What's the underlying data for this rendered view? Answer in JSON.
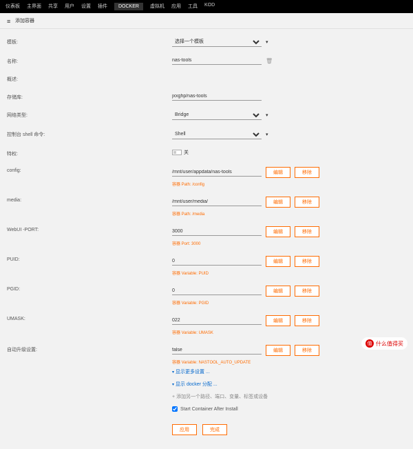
{
  "nav": {
    "items": [
      "仪表板",
      "主界面",
      "共享",
      "用户",
      "设置",
      "插件",
      "DOCKER",
      "虚拟机",
      "应用",
      "工具",
      "KOD"
    ],
    "active": 6
  },
  "header": {
    "title": "添加容器"
  },
  "labels": {
    "template": "模板:",
    "name": "名称:",
    "overview": "概述:",
    "repo": "存储库:",
    "network": "网络类型:",
    "shell": "控制台 shell 命令:",
    "priv": "特权:",
    "config": "config:",
    "media": "media:",
    "webui": "WebUI -PORT:",
    "puid": "PUID:",
    "pgid": "PGID:",
    "umask": "UMASK:",
    "autoupdate": "自动升级设置:"
  },
  "values": {
    "template": "选择一个模板",
    "name": "nas-tools",
    "repo": "jxxghp/nas-tools",
    "network": "Bridge",
    "shell": "Shell",
    "priv": "关",
    "config": "/mnt/user/appdata/nas-tools",
    "media": "/mnt/user/media/",
    "webui": "3000",
    "puid": "0",
    "pgid": "0",
    "umask": "022",
    "autoupdate": "false"
  },
  "hints": {
    "config": "容器 Path: /config",
    "media": "容器 Path: /media",
    "webui": "容器 Port: 3000",
    "puid": "容器 Variable: PUID",
    "pgid": "容器 Variable: PGID",
    "umask": "容器 Variable: UMASK",
    "autoupdate": "容器 Variable: NASTOOL_AUTO_UPDATE"
  },
  "btns": {
    "edit": "编辑",
    "delete": "移除",
    "apply": "应用",
    "done": "完成"
  },
  "links": {
    "more": "显示更多设置 ...",
    "docker": "显示 docker 分配 ...",
    "add": "添加另一个路径、端口、变量、标签或设备",
    "start": "Start Container After Install"
  },
  "watermark": {
    "brand": "值",
    "text": "什么值得买"
  }
}
